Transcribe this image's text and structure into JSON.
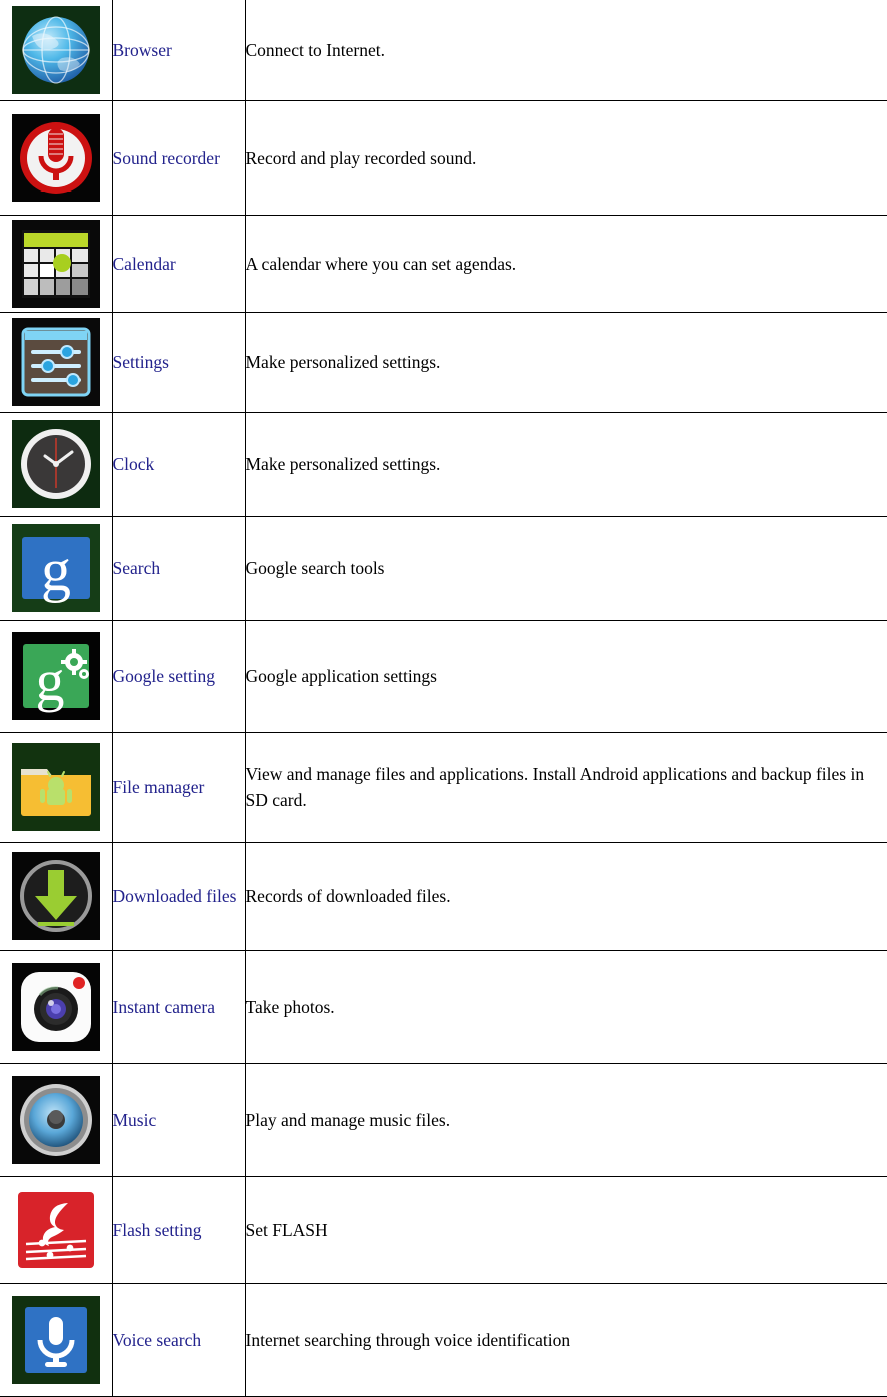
{
  "document": {
    "type": "application-list-table",
    "accent_name_color": "#22228c",
    "description_color": "#000000",
    "border_color": "#000000",
    "background": "#ffffff"
  },
  "table": {
    "columns": [
      "icon",
      "name",
      "description"
    ],
    "rows": [
      {
        "icon": "browser-globe-icon",
        "name": "Browser",
        "description": "Connect to Internet."
      },
      {
        "icon": "sound-recorder-microphone-icon",
        "name": "Sound recorder",
        "description": "Record and play recorded sound."
      },
      {
        "icon": "calendar-icon",
        "name": "Calendar",
        "description": "A calendar where you can set agendas."
      },
      {
        "icon": "settings-sliders-icon",
        "name": "Settings",
        "description": "Make personalized settings."
      },
      {
        "icon": "clock-analog-icon",
        "name": "Clock",
        "description": "Make personalized settings."
      },
      {
        "icon": "google-search-g-icon",
        "name": "Search",
        "description": "Google search tools"
      },
      {
        "icon": "google-setting-g-gear-icon",
        "name": "Google setting",
        "description": "Google application settings"
      },
      {
        "icon": "file-manager-folder-icon",
        "name": "File manager",
        "description": "View and manage files and applications. Install Android applications and backup files in SD card."
      },
      {
        "icon": "downloaded-files-arrow-icon",
        "name": "Downloaded files",
        "description": "Records of downloaded files."
      },
      {
        "icon": "instant-camera-icon",
        "name": "Instant camera",
        "description": "Take photos."
      },
      {
        "icon": "music-speaker-icon",
        "name": "Music",
        "description": "Play and manage music files."
      },
      {
        "icon": "flash-setting-icon",
        "name": "Flash setting",
        "description": "Set FLASH"
      },
      {
        "icon": "voice-search-microphone-icon",
        "name": "Voice search",
        "description": "Internet searching through voice identification"
      }
    ]
  }
}
